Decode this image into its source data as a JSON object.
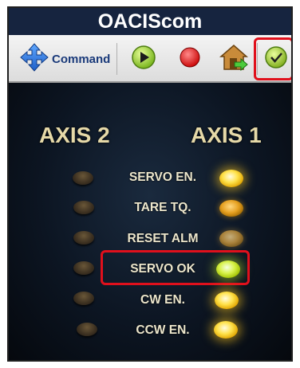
{
  "window": {
    "title": "OACIScom"
  },
  "toolbar": {
    "command_label": "Command",
    "buttons": [
      {
        "icon": "move-arrows-icon"
      },
      {
        "icon": "play-icon"
      },
      {
        "icon": "record-icon"
      },
      {
        "icon": "home-exit-icon"
      },
      {
        "icon": "checkmark-icon"
      }
    ]
  },
  "panel": {
    "axis_left": "AXIS 2",
    "axis_right": "AXIS 1",
    "rows": [
      {
        "label": "SERVO EN.",
        "axis1_state": "on",
        "axis2_state": "off"
      },
      {
        "label": "TARE TQ.",
        "axis1_state": "dim-amber",
        "axis2_state": "off"
      },
      {
        "label": "RESET ALM",
        "axis1_state": "dim",
        "axis2_state": "off"
      },
      {
        "label": "SERVO OK",
        "axis1_state": "on-green",
        "axis2_state": "off"
      },
      {
        "label": "CW EN.",
        "axis1_state": "on",
        "axis2_state": "off"
      },
      {
        "label": "CCW EN.",
        "axis1_state": "on",
        "axis2_state": "off"
      }
    ]
  },
  "colors": {
    "title_bg": "#16243f",
    "highlight": "#e0101c",
    "led_on": "#ffe24a",
    "led_green": "#d8f24a"
  }
}
